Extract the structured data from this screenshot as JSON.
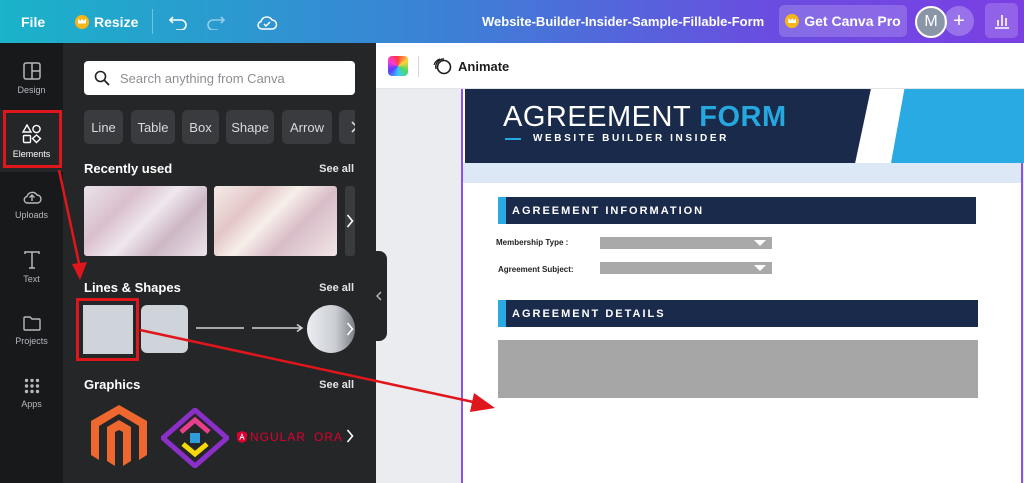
{
  "topbar": {
    "file_label": "File",
    "resize_label": "Resize",
    "doc_title": "Website-Builder-Insider-Sample-Fillable-Form",
    "get_pro_label": "Get Canva Pro",
    "avatar_initial": "M",
    "plus_label": "+"
  },
  "rail": {
    "items": [
      {
        "label": "Design",
        "icon": "design-icon"
      },
      {
        "label": "Elements",
        "icon": "elements-icon"
      },
      {
        "label": "Uploads",
        "icon": "cloud-upload-icon"
      },
      {
        "label": "Text",
        "icon": "text-icon"
      },
      {
        "label": "Projects",
        "icon": "folder-icon"
      },
      {
        "label": "Apps",
        "icon": "apps-grid-icon"
      }
    ],
    "active": "Elements"
  },
  "panel": {
    "search_placeholder": "Search anything from Canva",
    "chips": [
      "Line",
      "Table",
      "Box",
      "Shape",
      "Arrow"
    ],
    "recently_used": {
      "title": "Recently used",
      "see_all": "See all"
    },
    "lines_shapes": {
      "title": "Lines & Shapes",
      "see_all": "See all"
    },
    "graphics": {
      "title": "Graphics",
      "see_all": "See all",
      "items": [
        "magento-logo-icon",
        "puzzle-logo-icon",
        "angular-logo-icon"
      ]
    },
    "graphics_text": "NGULAR",
    "graphics_text2": "ORA"
  },
  "canvasbar": {
    "animate_label": "Animate"
  },
  "form": {
    "title_part1": "AGREEMENT",
    "title_part2": "FORM",
    "subtitle": "WEBSITE BUILDER INSIDER",
    "section1": "AGREEMENT INFORMATION",
    "field1_label": "Membership Type :",
    "field2_label": "Agreement Subject:",
    "section2": "AGREEMENT DETAILS"
  },
  "colors": {
    "accent_blue": "#29aae2",
    "navy": "#1a2a4a",
    "annotation_red": "#e0161d"
  }
}
